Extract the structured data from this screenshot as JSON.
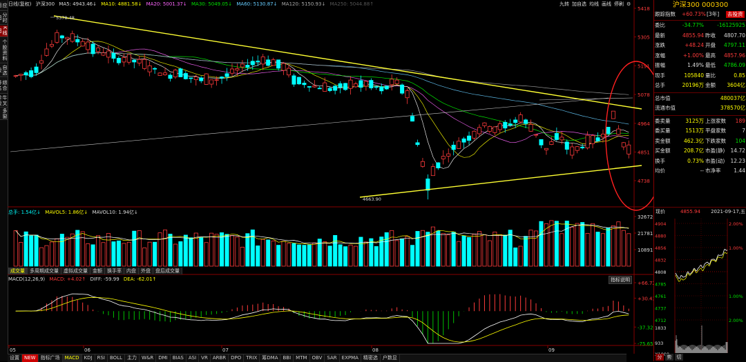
{
  "header": {
    "period": "日线(复权)",
    "symbol": "沪深300",
    "ma5": "MA5: 4943.46↓",
    "ma10": "MA10: 4881.58↓",
    "ma20": "MA20: 5001.37↓",
    "ma30": "MA30: 5049.05↓",
    "ma60": "MA60: 5130.87↓",
    "ma120": "MA120: 5150.93↓",
    "ma250": "MA250: 5044.88↑",
    "tools": [
      "九转",
      "加自选",
      "均线",
      "画线",
      "停刷"
    ]
  },
  "left_tabs": [
    "应用",
    "分时图",
    "K线图",
    "个股资料",
    "自选股",
    "综合排名",
    "牛叉诊股",
    "多窗"
  ],
  "colors": {
    "up": "#ff3b3b",
    "down": "#00ffff",
    "ma5": "#ffffff",
    "ma10": "#ffff00",
    "ma20": "#ff66ff",
    "ma30": "#00ff00",
    "ma60": "#66ccff",
    "ma120": "#aaaaaa",
    "ma250": "#cccccc",
    "trend": "#ffff33",
    "circle": "#ff2020"
  },
  "price_axis": [
    "5418",
    "5305",
    "5191",
    "5078",
    "4964",
    "4851",
    "4738"
  ],
  "annotations": {
    "high": "5378.48",
    "low": "4663.90"
  },
  "volume": {
    "header": [
      "总手: 1.54亿↓",
      "MAVOL5: 1.86亿↓",
      "MAVOL10: 1.94亿↓"
    ],
    "axis": [
      "32672",
      "21781",
      "10891"
    ],
    "tabs": [
      "成交量",
      "多周期成交量",
      "虚拟成交量",
      "金额",
      "换手率",
      "内盘",
      "外盘",
      "盘后成交量"
    ]
  },
  "macd": {
    "header": {
      "name": "MACD(12,26,9)",
      "macd": "MACD: +4.02↑",
      "diff": "DIFF: -59.99",
      "dea": "DEA: -62.01↑"
    },
    "axis": [
      "+66.72",
      "+30.43",
      "-37.32",
      "-75.65"
    ],
    "help": "指标说明"
  },
  "xaxis": [
    "05",
    "06",
    "07",
    "08",
    "09"
  ],
  "bottom_tabs": [
    "设置",
    "NEW",
    "指标广场",
    "MACD",
    "KDJ",
    "RSI",
    "BOLL",
    "主力",
    "W&R",
    "DMI",
    "BIAS",
    "ASI",
    "VR",
    "ARBR",
    "DPO",
    "TRIX",
    "筹DMA",
    "BBI",
    "MTM",
    "OBV",
    "SAR",
    "EXPMA",
    "精密选",
    "户数显"
  ],
  "quote": {
    "title": "沪深300 000300",
    "track_label": "跟踪指数",
    "track_value": "+60.73%",
    "track_period": "[3年]",
    "buy_button": "去投资",
    "rows": [
      {
        "l": "委比",
        "v1": "-34.77%",
        "c1": "green",
        "v2": "-16125925",
        "c2": "green"
      },
      {
        "l": "最新",
        "v1": "4855.94",
        "c1": "red",
        "l2": "昨收",
        "v2": "4807.70",
        "c2": "white"
      },
      {
        "l": "涨跌",
        "v1": "+48.24",
        "c1": "red",
        "l2": "开盘",
        "v2": "4797.11",
        "c2": "green"
      },
      {
        "l": "涨幅",
        "v1": "+1.00%",
        "c1": "red",
        "l2": "最高",
        "v2": "4857.96",
        "c2": "red"
      },
      {
        "l": "振幅",
        "v1": "1.49%",
        "c1": "white",
        "l2": "最低",
        "v2": "4786.09",
        "c2": "green"
      },
      {
        "l": "现手",
        "v1": "105840",
        "c1": "yellow",
        "l2": "量比",
        "v2": "0.85",
        "c2": "yellow"
      },
      {
        "l": "总手",
        "v1": "20196万",
        "c1": "yellow",
        "l2": "金额",
        "v2": "3604亿",
        "c2": "yellow"
      }
    ],
    "rows2": [
      {
        "l": "总市值",
        "v2": "480037亿",
        "c2": "yellow"
      },
      {
        "l": "流通市值",
        "v2": "378570亿",
        "c2": "yellow"
      }
    ],
    "rows3": [
      {
        "l": "委卖量",
        "v1": "3125万",
        "c1": "yellow",
        "l2": "上涨家数",
        "v2": "189",
        "c2": "red"
      },
      {
        "l": "委买量",
        "v1": "1513万",
        "c1": "yellow",
        "l2": "平盘家数",
        "v2": "7",
        "c2": "white"
      },
      {
        "l": "卖金额",
        "v1": "462.3亿",
        "c1": "yellow",
        "l2": "下跌家数",
        "v2": "104",
        "c2": "green"
      },
      {
        "l": "买金额",
        "v1": "208.7亿",
        "c1": "yellow",
        "l2": "市盈(静)",
        "v2": "14.72",
        "c2": "white"
      },
      {
        "l": "换手",
        "v1": "0.73%",
        "c1": "yellow",
        "l2": "市盈(动)",
        "v2": "12.23",
        "c2": "white"
      },
      {
        "l": "均价",
        "v1": "--",
        "c1": "white",
        "l2": "市净率",
        "v2": "1.44",
        "c2": "white"
      }
    ],
    "mini": {
      "label": "现价",
      "price": "4855.94",
      "date": "2021-09-17,五",
      "left_axis": [
        "4904",
        "4880",
        "4856",
        "4832",
        "4808",
        "4785",
        "4761",
        "4737",
        "4712"
      ],
      "right_axis": [
        "2.00%",
        "1.00%",
        "",
        "1.00%",
        "2.00%"
      ],
      "vol_axis": [
        "1833",
        "933",
        "X1000"
      ],
      "tabs": [
        "分",
        "势",
        "切"
      ]
    }
  }
}
